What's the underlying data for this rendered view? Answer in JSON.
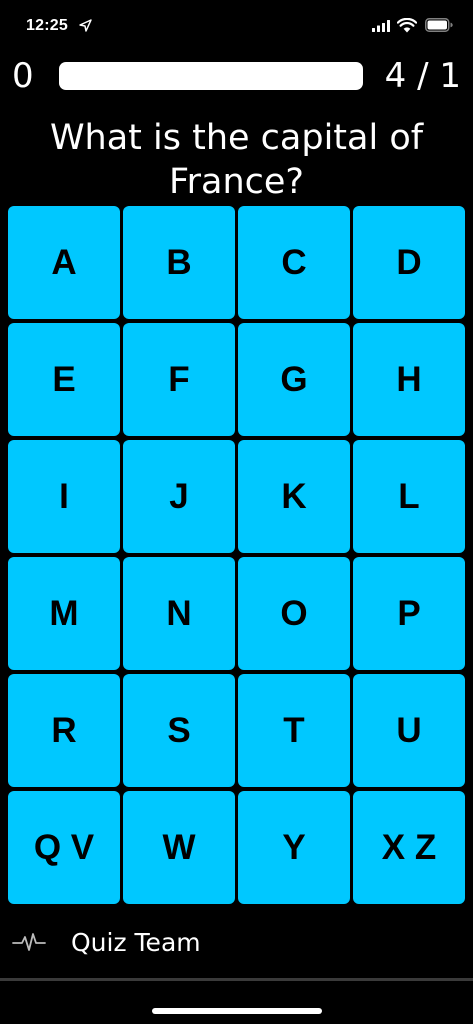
{
  "status_bar": {
    "time": "12:25",
    "icons": [
      "location-arrow-icon",
      "cellular-signal-icon",
      "wifi-icon",
      "battery-icon"
    ]
  },
  "progress": {
    "score": "0",
    "counter": "4 / 1",
    "fill_percent": 100
  },
  "question": {
    "text": "What is the capital of France?"
  },
  "letters": [
    {
      "label": "A"
    },
    {
      "label": "B"
    },
    {
      "label": "C"
    },
    {
      "label": "D"
    },
    {
      "label": "E"
    },
    {
      "label": "F"
    },
    {
      "label": "G"
    },
    {
      "label": "H"
    },
    {
      "label": "I"
    },
    {
      "label": "J"
    },
    {
      "label": "K"
    },
    {
      "label": "L"
    },
    {
      "label": "M"
    },
    {
      "label": "N"
    },
    {
      "label": "O"
    },
    {
      "label": "P"
    },
    {
      "label": "R"
    },
    {
      "label": "S"
    },
    {
      "label": "T"
    },
    {
      "label": "U"
    },
    {
      "label": "Q V"
    },
    {
      "label": "W"
    },
    {
      "label": "Y"
    },
    {
      "label": "X Z"
    }
  ],
  "footer": {
    "icon": "activity-pulse-icon",
    "team_name": "Quiz Team"
  },
  "colors": {
    "background": "#000000",
    "key_fill": "#00c8ff",
    "key_text": "#000000",
    "text": "#ffffff"
  }
}
